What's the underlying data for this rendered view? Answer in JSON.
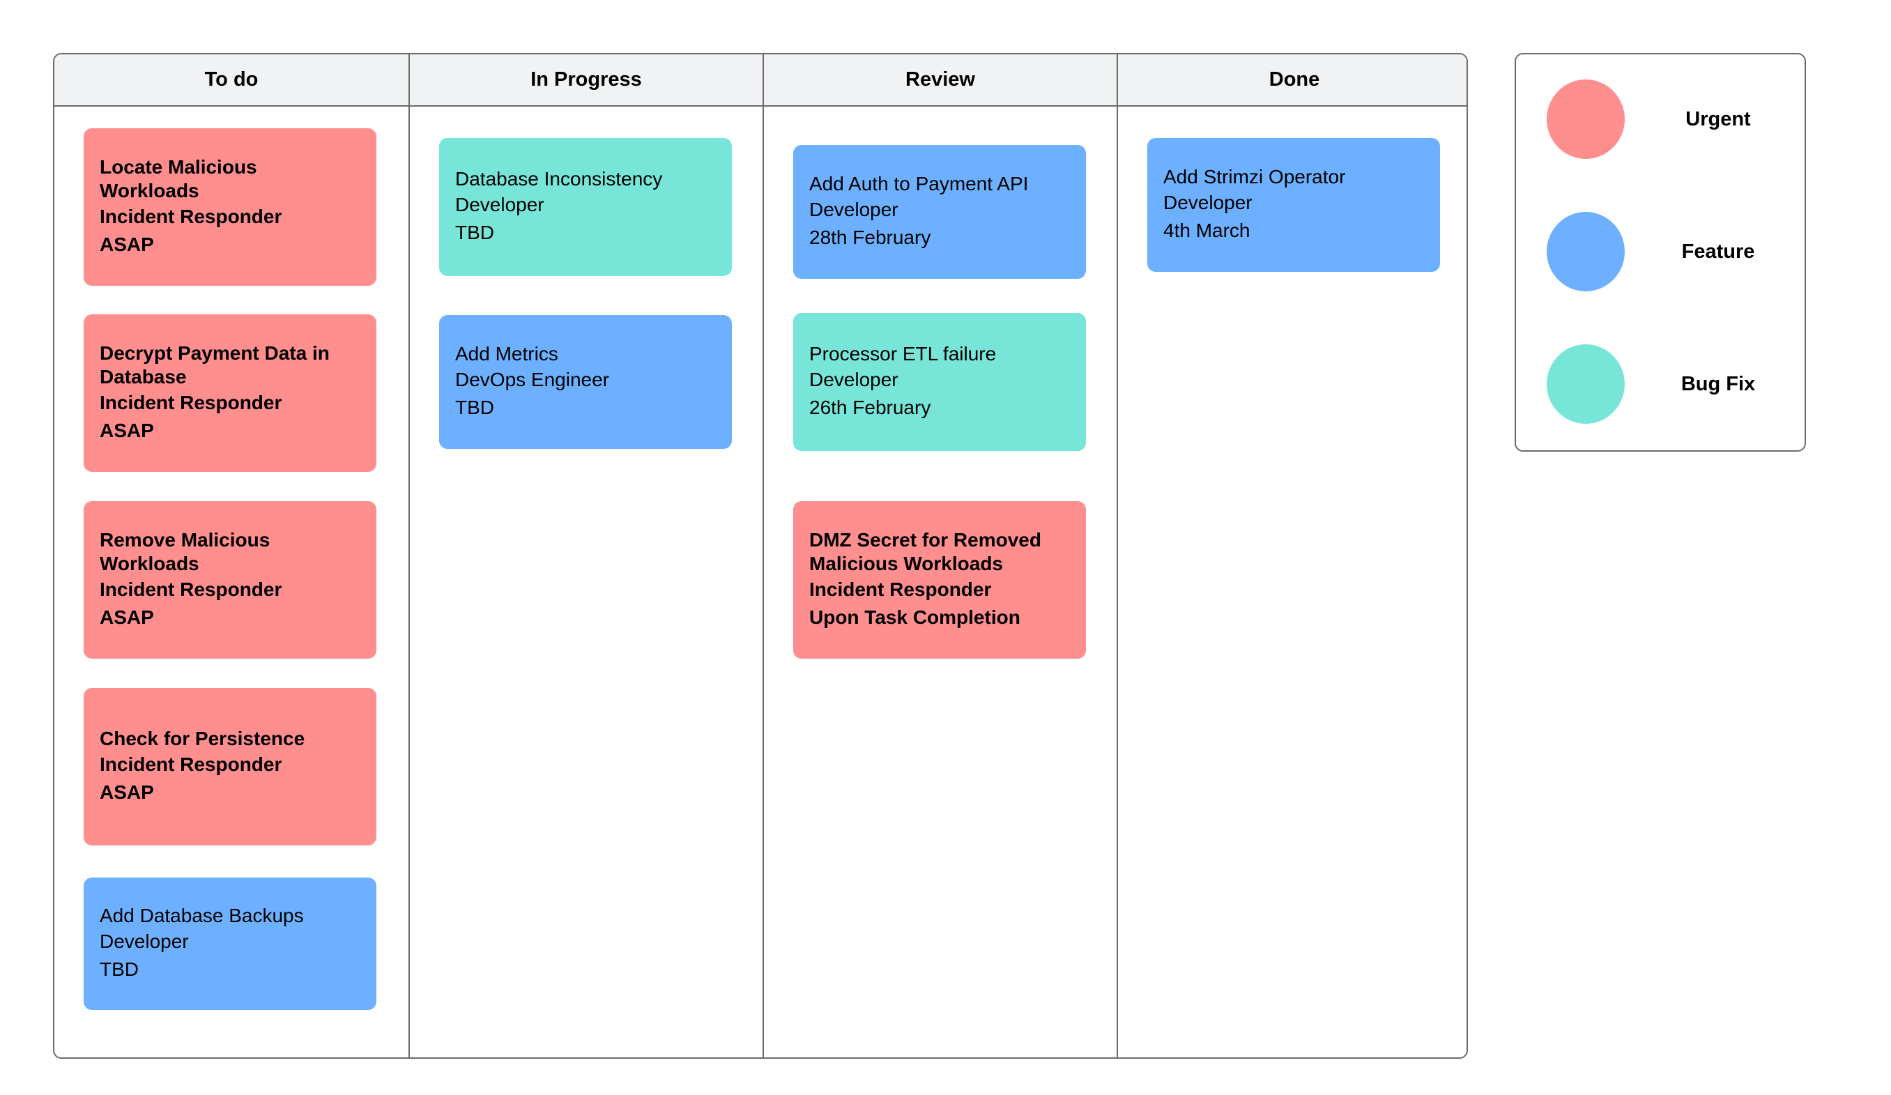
{
  "colors": {
    "urgent": "#ff8e8e",
    "feature": "#6db0ff",
    "bugfix": "#77e5d8",
    "header_bg": "#f1f2f4",
    "border": "#6b6b6b"
  },
  "columns": [
    {
      "title": "To do",
      "cards": [
        {
          "type": "urgent",
          "title": "Locate Malicious Workloads",
          "owner": "Incident Responder",
          "due": "ASAP"
        },
        {
          "type": "urgent",
          "title": "Decrypt Payment Data in Database",
          "owner": "Incident Responder",
          "due": "ASAP"
        },
        {
          "type": "urgent",
          "title": "Remove Malicious Workloads",
          "owner": "Incident Responder",
          "due": "ASAP"
        },
        {
          "type": "urgent",
          "title": "Check for Persistence",
          "owner": "Incident Responder",
          "due": "ASAP"
        },
        {
          "type": "feature",
          "title": "Add Database Backups",
          "owner": "Developer",
          "due": "TBD"
        }
      ]
    },
    {
      "title": "In Progress",
      "cards": [
        {
          "type": "bugfix",
          "title": "Database Inconsistency",
          "owner": "Developer",
          "due": "TBD"
        },
        {
          "type": "feature",
          "title": "Add Metrics",
          "owner": "DevOps Engineer",
          "due": "TBD"
        }
      ]
    },
    {
      "title": "Review",
      "cards": [
        {
          "type": "feature",
          "title": "Add Auth to Payment API",
          "owner": "Developer",
          "due": "28th February"
        },
        {
          "type": "bugfix",
          "title": "Processor ETL failure",
          "owner": "Developer",
          "due": "26th February"
        },
        {
          "type": "urgent",
          "title": "DMZ Secret for Removed Malicious Workloads",
          "owner": "Incident Responder",
          "due": "Upon Task Completion"
        }
      ]
    },
    {
      "title": "Done",
      "cards": [
        {
          "type": "feature",
          "title": "Add Strimzi Operator",
          "owner": "Developer",
          "due": "4th March"
        }
      ]
    }
  ],
  "legend": [
    {
      "type": "urgent",
      "label": "Urgent"
    },
    {
      "type": "feature",
      "label": "Feature"
    },
    {
      "type": "bugfix",
      "label": "Bug Fix"
    }
  ]
}
